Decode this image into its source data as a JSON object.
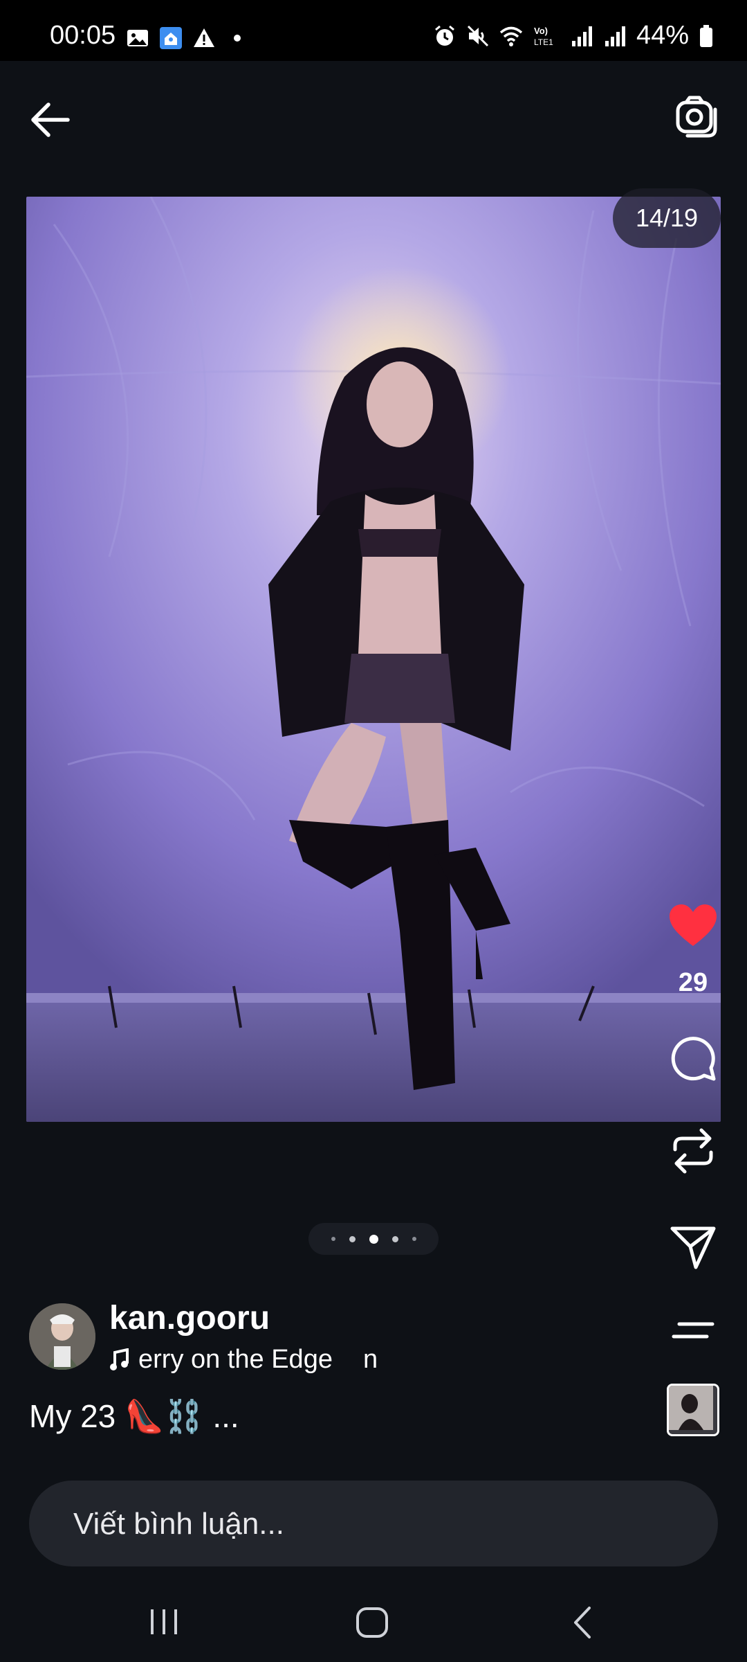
{
  "status_bar": {
    "time": "00:05",
    "battery": "44%",
    "left_icons": [
      "image-icon",
      "home-app-icon",
      "warning-icon",
      "dot-icon"
    ],
    "right_icons": [
      "alarm-icon",
      "mute-icon",
      "wifi-icon",
      "volte-icon",
      "signal-icon",
      "signal-icon",
      "battery-icon"
    ]
  },
  "top_bar": {
    "back_icon": "arrow-left-icon",
    "camera_icon": "camera-icon"
  },
  "post": {
    "counter": "14/19",
    "like_count": "29",
    "carousel_dots": 5,
    "active_dot": 2
  },
  "author": {
    "username": "kan.gooru",
    "music_text": "erry on the Edge",
    "music_suffix": "n",
    "caption": "My 23 👠⛓️ ..."
  },
  "comment": {
    "placeholder": "Viết bình luận..."
  },
  "colors": {
    "background": "#0e1116",
    "like_red": "#ff3040",
    "photo_purple": "#8b7fd1"
  }
}
